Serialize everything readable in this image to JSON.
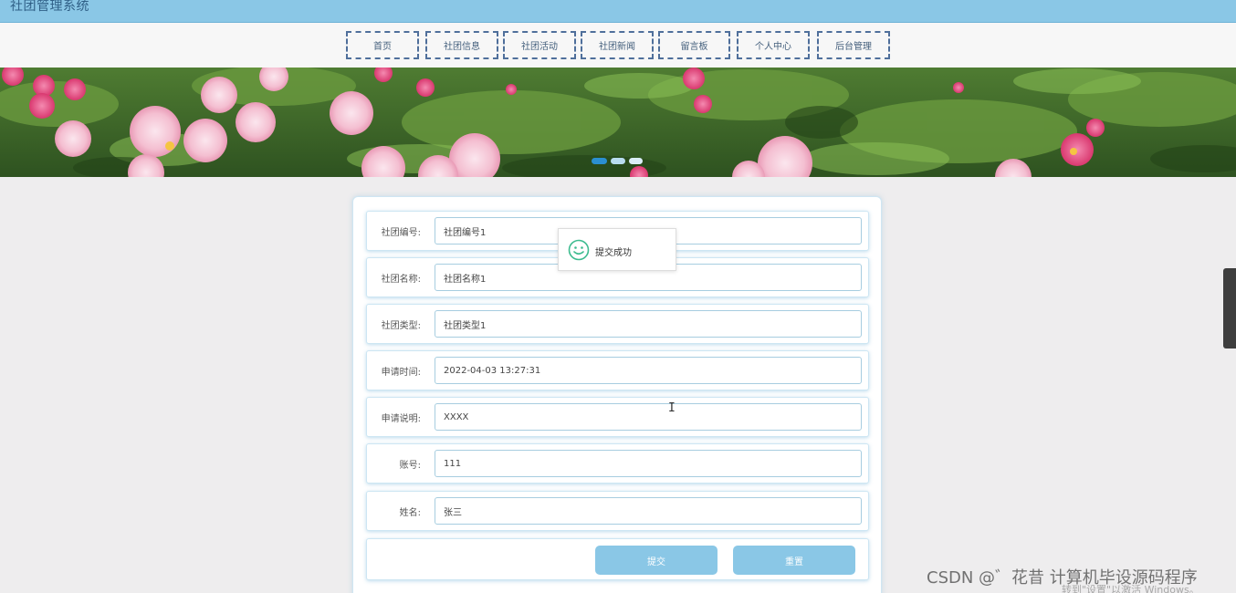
{
  "app": {
    "title": "社团管理系统"
  },
  "nav": {
    "items": [
      {
        "label": "首页"
      },
      {
        "label": "社团信息"
      },
      {
        "label": "社团活动"
      },
      {
        "label": "社团新闻"
      },
      {
        "label": "留言板"
      },
      {
        "label": "个人中心"
      },
      {
        "label": "后台管理"
      }
    ]
  },
  "banner": {
    "slide_count": 3,
    "active_slide": 1
  },
  "form": {
    "fields": [
      {
        "label": "社团编号:",
        "value": "社团编号1"
      },
      {
        "label": "社团名称:",
        "value": "社团名称1"
      },
      {
        "label": "社团类型:",
        "value": "社团类型1"
      },
      {
        "label": "申请时间:",
        "value": "2022-04-03 13:27:31"
      },
      {
        "label": "申请说明:",
        "value": "XXXX"
      },
      {
        "label": "账号:",
        "value": "111"
      },
      {
        "label": "姓名:",
        "value": "张三"
      }
    ],
    "submit_label": "提交",
    "reset_label": "重置"
  },
  "toast": {
    "text": "提交成功",
    "icon": "smile-icon"
  },
  "watermark": {
    "text": "CSDN @゛花昔 计算机毕设源码程序",
    "activate_text": "转到\"设置\"以激活 Windows。"
  },
  "colors": {
    "accent": "#8ac7e6",
    "nav_border": "#4f6f9b",
    "toast_icon": "#3dbb8f"
  }
}
